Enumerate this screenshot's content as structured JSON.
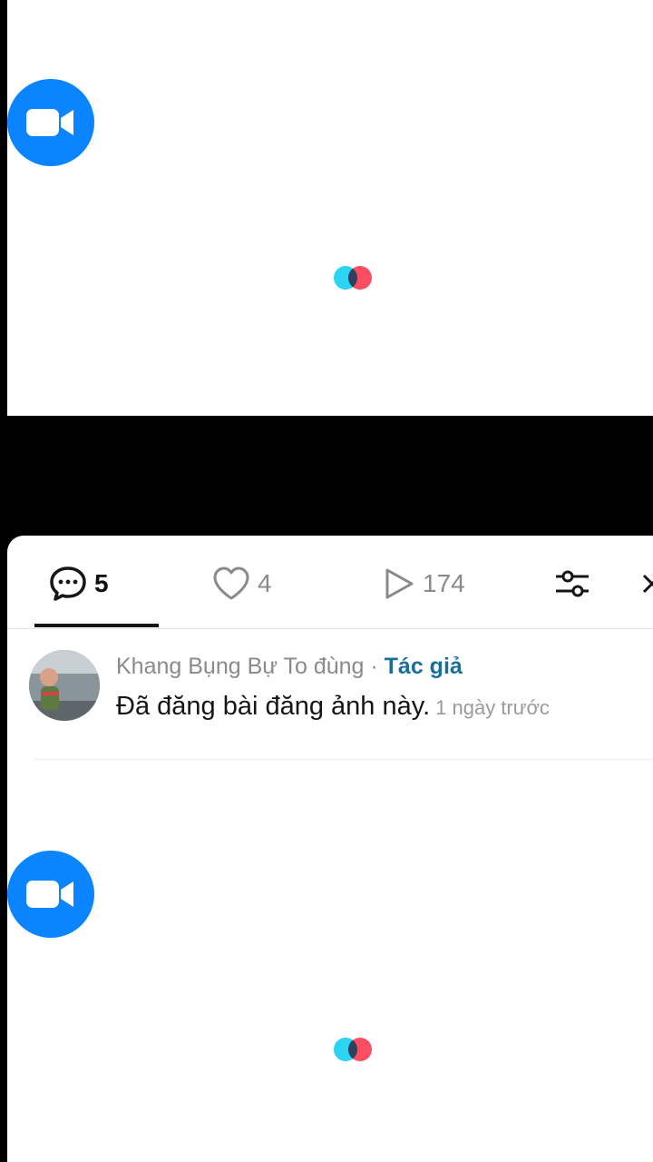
{
  "icons": {
    "camera": "video-camera-icon",
    "comment": "comment-bubble-icon",
    "like": "heart-icon",
    "views": "play-icon",
    "filter": "filter-sliders-icon",
    "close": "close-icon"
  },
  "colors": {
    "camera_button": "#0a84ff",
    "loader_cyan": "#2bd4f3",
    "loader_red": "#fb4e63",
    "author_badge": "#1a6f9a"
  },
  "tabs": {
    "comments_count": "5",
    "likes_count": "4",
    "views_count": "174"
  },
  "comment": {
    "author": "Khang Bụng Bự To đùng",
    "separator": " · ",
    "badge": "Tác giả",
    "text": "Đã đăng bài đăng ảnh này.",
    "time": "1 ngày trước"
  }
}
